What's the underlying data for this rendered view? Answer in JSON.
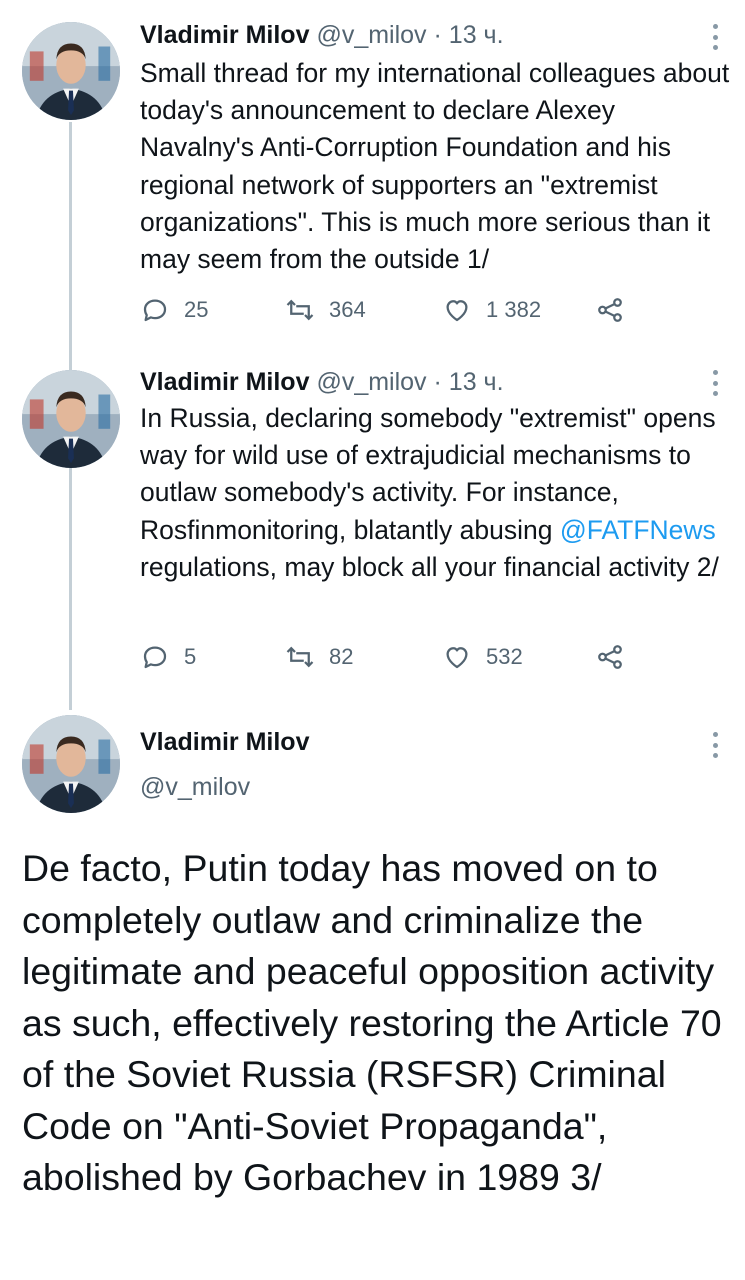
{
  "tweets": [
    {
      "author_name": "Vladimir Milov",
      "handle": "@v_milov",
      "separator": "·",
      "time": "13 ч.",
      "text": "Small thread for my international colleagues about today's announcement to declare Alexey Navalny's Anti-Corruption Foundation and his regional network of supporters an \"extremist organizations\". This is much more serious than it may seem from the outside 1/",
      "replies": "25",
      "retweets": "364",
      "likes": "1 382"
    },
    {
      "author_name": "Vladimir Milov",
      "handle": "@v_milov",
      "separator": "·",
      "time": "13 ч.",
      "text_before": "In Russia, declaring somebody \"extremist\" opens way for wild use of extrajudicial mechanisms to outlaw somebody's activity. For instance, Rosfinmonitoring, blatantly abusing ",
      "mention": "@FATFNews",
      "text_after": " regulations, may block all your financial activity 2/",
      "replies": "5",
      "retweets": "82",
      "likes": "532"
    },
    {
      "author_name": "Vladimir Milov",
      "handle": "@v_milov",
      "text": "De facto, Putin today has moved on to completely outlaw and criminalize the legitimate and peaceful opposition activity as such, effectively restoring the Article 70 of the Soviet Russia (RSFSR) Criminal Code on \"Anti-Soviet Propaganda\", abolished by Gorbachev in 1989 3/"
    }
  ],
  "icons": {
    "reply": "reply-icon",
    "retweet": "retweet-icon",
    "like": "heart-icon",
    "share": "share-icon",
    "more": "more-vertical-icon"
  },
  "colors": {
    "text": "#0f1419",
    "secondary": "#536471",
    "link": "#1d9bf0",
    "thread_line": "#c4cfd6"
  }
}
